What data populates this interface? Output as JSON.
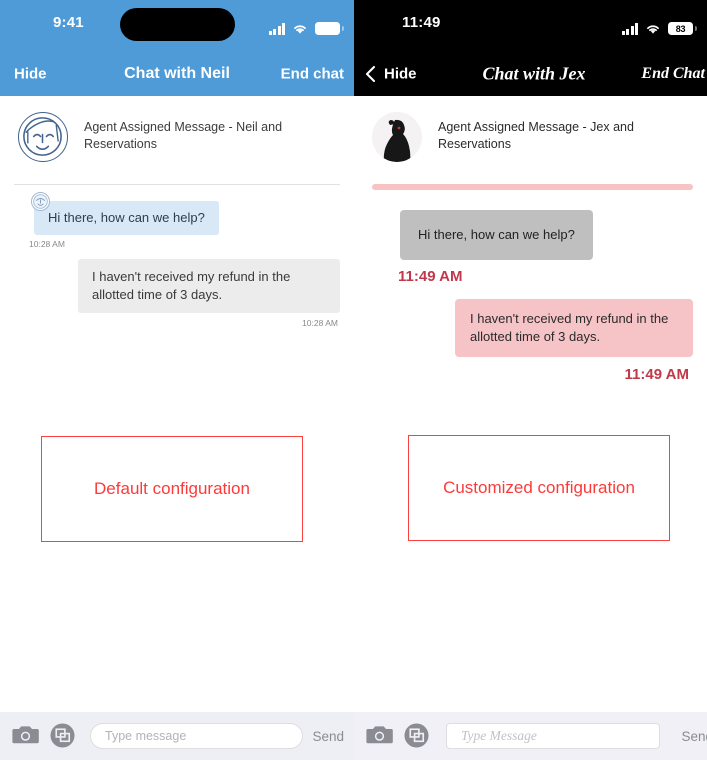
{
  "left_panel": {
    "status_bar": {
      "time": "9:41",
      "signal_icon": "cellular-signal-icon",
      "wifi_icon": "wifi-icon",
      "battery_icon": "battery-icon",
      "battery_level": "",
      "background_color": "#4e9bd8"
    },
    "nav": {
      "hide_label": "Hide",
      "title": "Chat with Neil",
      "end_label": "End chat",
      "background_color": "#4e9bd8",
      "has_back_chevron": false
    },
    "assigned": {
      "avatar_icon": "face-line-art-avatar",
      "text": "Agent Assigned Message - Neil and Reservations"
    },
    "messages": [
      {
        "direction": "incoming",
        "text": "Hi there, how can we help?",
        "timestamp": "10:28 AM",
        "bubble_color": "#d9e8f6",
        "has_mini_avatar": true
      },
      {
        "direction": "outgoing",
        "text": "I haven't received my refund in the allotted time of 3 days.",
        "timestamp": "10:28 AM",
        "bubble_color": "#ececec",
        "has_mini_avatar": false
      }
    ],
    "composer": {
      "camera_icon": "camera-icon",
      "gallery_icon": "gallery-stack-icon",
      "placeholder": "Type message",
      "send_label": "Send"
    }
  },
  "right_panel": {
    "status_bar": {
      "time": "11:49",
      "signal_icon": "cellular-signal-icon",
      "wifi_icon": "wifi-icon",
      "battery_icon": "battery-icon",
      "battery_level": "83",
      "background_color": "#000000"
    },
    "nav": {
      "hide_label": "Hide",
      "title": "Chat with Jex",
      "end_label": "End Chat",
      "background_color": "#000000",
      "has_back_chevron": true,
      "back_icon": "chevron-left-icon"
    },
    "assigned": {
      "avatar_icon": "photo-avatar",
      "text": "Agent Assigned Message - Jex and Reservations"
    },
    "messages": [
      {
        "direction": "incoming",
        "text": "Hi there, how can we help?",
        "timestamp": "11:49 AM",
        "bubble_color": "#bfbfbf",
        "has_mini_avatar": false
      },
      {
        "direction": "outgoing",
        "text": "I haven't received my refund in the allotted time of 3 days.",
        "timestamp": "11:49 AM",
        "bubble_color": "#f6c3c7",
        "has_mini_avatar": false
      }
    ],
    "divider_color": "#f7c3c3",
    "timestamp_color": "#c0394b",
    "composer": {
      "camera_icon": "camera-icon",
      "gallery_icon": "gallery-stack-icon",
      "placeholder": "Type Message",
      "send_label": "Send"
    }
  },
  "annotations": {
    "left_label": "Default configuration",
    "right_label": "Customized configuration",
    "color": "#fc3a3a"
  }
}
